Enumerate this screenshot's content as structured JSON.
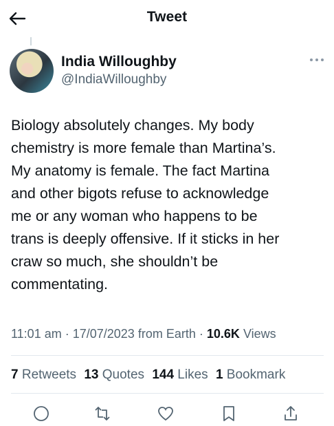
{
  "header": {
    "title": "Tweet",
    "back_icon": "arrow-left-icon"
  },
  "author": {
    "name": "India Willoughby",
    "handle": "@IndiaWilloughby"
  },
  "tweet": {
    "text": "Biology absolutely changes. My body\nchemistry is more female than Martina’s.\nMy anatomy is female. The fact Martina\nand other bigots refuse to acknowledge\nme or any woman who happens to be\ntrans is deeply offensive. If it sticks in her\ncraw so much, she shouldn’t be\ncommentating."
  },
  "meta": {
    "time": "11:01 am",
    "date": "17/07/2023",
    "source": "from Earth",
    "views_count": "10.6K",
    "views_label": "Views"
  },
  "stats": {
    "retweets": {
      "count": "7",
      "label": "Retweets"
    },
    "quotes": {
      "count": "13",
      "label": "Quotes"
    },
    "likes": {
      "count": "144",
      "label": "Likes"
    },
    "bookmarks": {
      "count": "1",
      "label": "Bookmark"
    }
  },
  "colors": {
    "text": "#0f1419",
    "secondary": "#536471",
    "divider": "#e1e8ed"
  }
}
